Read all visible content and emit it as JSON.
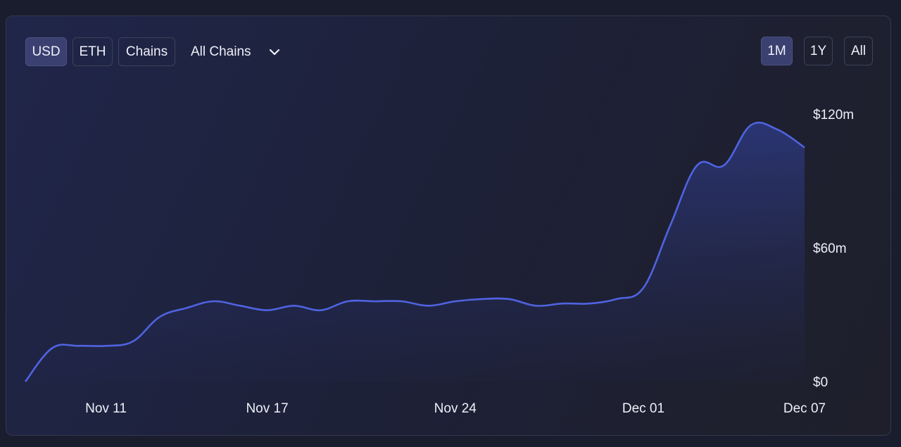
{
  "controls": {
    "currency": [
      {
        "label": "USD",
        "active": true
      },
      {
        "label": "ETH",
        "active": false
      },
      {
        "label": "Chains",
        "active": false
      }
    ],
    "chain_filter": {
      "label": "All Chains",
      "icon": "chevron-down-icon"
    },
    "ranges": [
      {
        "label": "1M",
        "active": true
      },
      {
        "label": "1Y",
        "active": false
      },
      {
        "label": "All",
        "active": false
      }
    ]
  },
  "colors": {
    "line": "#4f63e0",
    "active_button": "#3a4070"
  },
  "chart_data": {
    "type": "area",
    "title": "",
    "xlabel": "",
    "ylabel": "",
    "x_ticks": [
      "Nov 11",
      "Nov 17",
      "Nov 24",
      "Dec 01",
      "Dec 07"
    ],
    "y_ticks": [
      "$0",
      "$60m",
      "$120m"
    ],
    "ylim": [
      0,
      120
    ],
    "y_unit": "$m",
    "grid": false,
    "series": [
      {
        "x": [
          "Nov 08",
          "Nov 09",
          "Nov 10",
          "Nov 11",
          "Nov 12",
          "Nov 13",
          "Nov 14",
          "Nov 15",
          "Nov 16",
          "Nov 17",
          "Nov 18",
          "Nov 19",
          "Nov 20",
          "Nov 21",
          "Nov 22",
          "Nov 23",
          "Nov 24",
          "Nov 25",
          "Nov 26",
          "Nov 27",
          "Nov 28",
          "Nov 29",
          "Nov 30",
          "Dec 01",
          "Dec 02",
          "Dec 03",
          "Dec 04",
          "Dec 05",
          "Dec 06",
          "Dec 07"
        ],
        "values": [
          0,
          15,
          16,
          16,
          18,
          29,
          33,
          36,
          34,
          32,
          34,
          32,
          36,
          36,
          36,
          34,
          36,
          37,
          37,
          34,
          35,
          35,
          37,
          42,
          70,
          97,
          97,
          115,
          113,
          105
        ]
      }
    ]
  }
}
